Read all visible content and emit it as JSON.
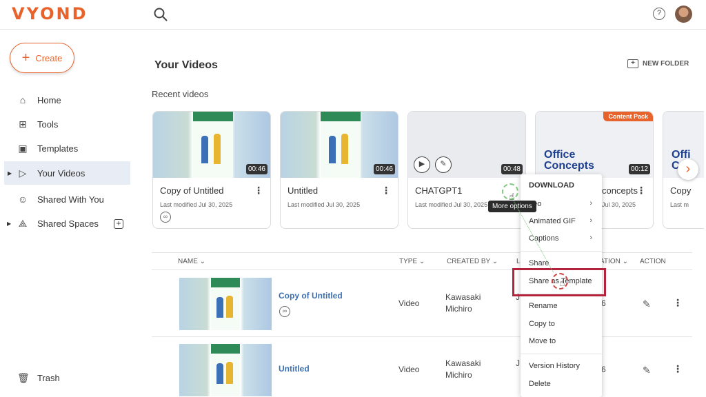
{
  "app": {
    "logo": "VYOND"
  },
  "sidebar": {
    "create_label": "Create",
    "items": [
      {
        "label": "Home",
        "icon": "home-icon"
      },
      {
        "label": "Tools",
        "icon": "grid-icon"
      },
      {
        "label": "Templates",
        "icon": "templates-icon"
      },
      {
        "label": "Your Videos",
        "icon": "video-file-icon",
        "active": true
      },
      {
        "label": "Shared With You",
        "icon": "people-icon"
      },
      {
        "label": "Shared Spaces",
        "icon": "network-icon"
      }
    ],
    "trash_label": "Trash"
  },
  "main": {
    "title": "Your Videos",
    "new_folder": "NEW FOLDER",
    "recent_label": "Recent videos",
    "recent": [
      {
        "title": "Copy of Untitled",
        "meta": "Last modified Jul 30, 2025",
        "duration": "00:46"
      },
      {
        "title": "Untitled",
        "meta": "Last modified Jul 30, 2025",
        "duration": "00:46"
      },
      {
        "title": "CHATGPT1",
        "meta": "Last modified Jul 30, 2025",
        "duration": "00:48"
      },
      {
        "title": "Office Concepts",
        "title_visible": "concepts",
        "meta": "Jul 30, 2025",
        "duration": "00:12",
        "badge": "Content Pack",
        "thumb_text": "Office Concepts"
      },
      {
        "title": "Copy",
        "meta": "Last m",
        "thumb_text": "Offi C"
      }
    ],
    "table": {
      "headers": {
        "name": "NAME",
        "type": "TYPE",
        "created_by": "CREATED BY",
        "last": "L",
        "duration": "ATION",
        "action": "ACTION"
      },
      "rows": [
        {
          "title": "Copy of Untitled",
          "type": "Video",
          "creator": "Kawasaki Michiro",
          "cut": "J K",
          "num": "6"
        },
        {
          "title": "Untitled",
          "type": "Video",
          "creator": "Kawasaki Michiro",
          "cut": "J K",
          "num": "6"
        }
      ]
    }
  },
  "tooltip": "More options",
  "menu": {
    "download": "DOWNLOAD",
    "video": "deo",
    "animated_gif": "Animated GIF",
    "captions": "Captions",
    "share": "Share",
    "share_template": "Share as Template",
    "rename": "Rename",
    "copy_to": "Copy to",
    "move_to": "Move to",
    "version_history": "Version History",
    "delete": "Delete"
  },
  "colors": {
    "brand": "#e8632b",
    "link": "#3c6fb0",
    "highlight": "#b4233c"
  }
}
